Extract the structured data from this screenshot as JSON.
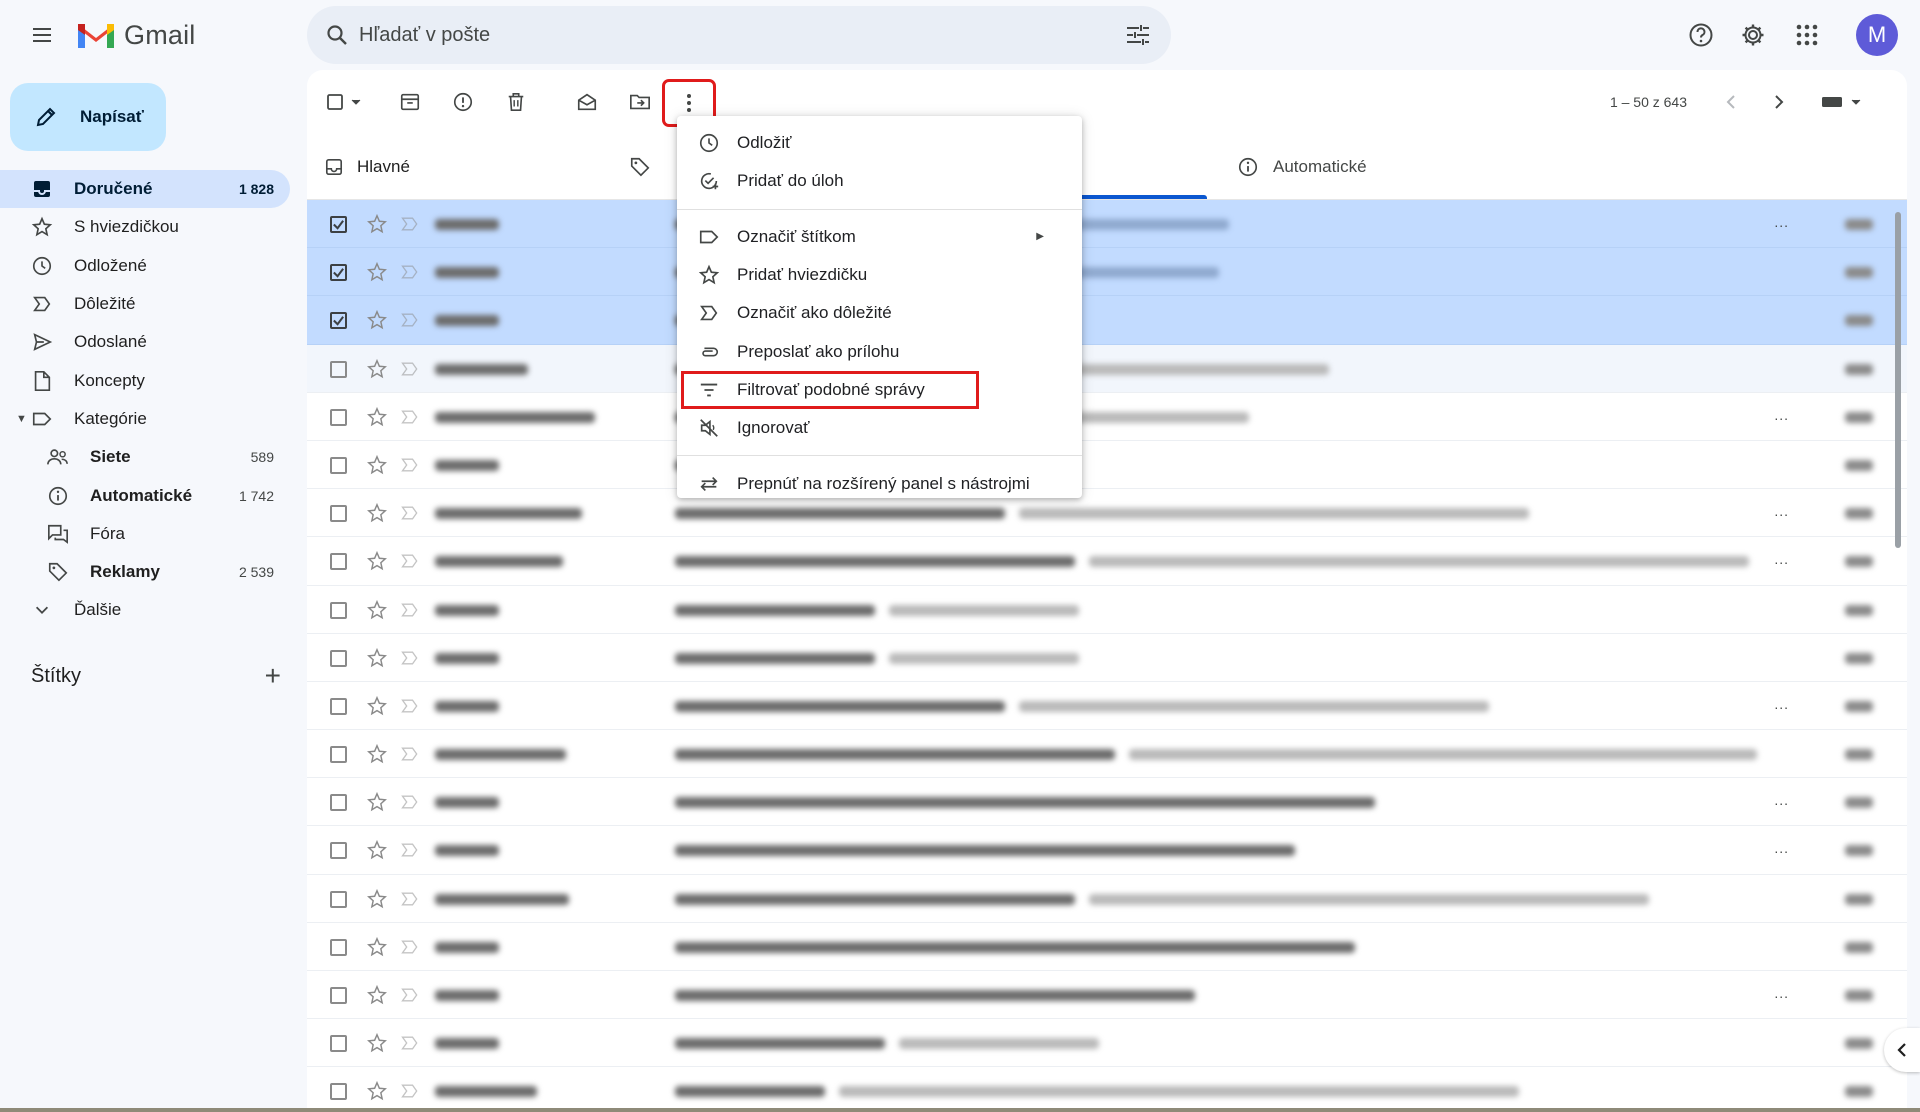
{
  "app": {
    "name": "Gmail",
    "avatar_letter": "M"
  },
  "search": {
    "placeholder": "Hľadať v pošte"
  },
  "compose": {
    "label": "Napísať"
  },
  "sidebar": {
    "items": [
      {
        "label": "Doručené",
        "count": "1 828"
      },
      {
        "label": "S hviezdičkou",
        "count": ""
      },
      {
        "label": "Odložené",
        "count": ""
      },
      {
        "label": "Dôležité",
        "count": ""
      },
      {
        "label": "Odoslané",
        "count": ""
      },
      {
        "label": "Koncepty",
        "count": ""
      },
      {
        "label": "Kategórie",
        "count": ""
      },
      {
        "label": "Siete",
        "count": "589"
      },
      {
        "label": "Automatické",
        "count": "1 742"
      },
      {
        "label": "Fóra",
        "count": ""
      },
      {
        "label": "Reklamy",
        "count": "2 539"
      },
      {
        "label": "Ďalšie",
        "count": ""
      }
    ],
    "labels_title": "Štítky",
    "labels_add": "+"
  },
  "toolbar": {
    "pagination": "1 – 50 z 643"
  },
  "tabs": [
    {
      "label": "Hlavné"
    },
    {
      "label": "Automatické"
    }
  ],
  "tab_partial_letter": "I",
  "menu": {
    "items": [
      {
        "label": "Odložiť"
      },
      {
        "label": "Pridať do úloh"
      },
      {
        "label": "Označiť štítkom"
      },
      {
        "label": "Pridať hviezdičku"
      },
      {
        "label": "Označiť ako dôležité"
      },
      {
        "label": "Preposlať ako prílohu"
      },
      {
        "label": "Filtrovať podobné správy"
      },
      {
        "label": "Ignorovať"
      },
      {
        "label": "Prepnúť na rozšírený panel s nástrojmi"
      }
    ]
  },
  "row_dots": "...",
  "colors": {
    "accent": "#0b57d0",
    "compose_bg": "#c2e7ff",
    "selected_row": "#c2dbff",
    "highlight_outline": "#e01b1b",
    "avatar": "#5e5bd8"
  }
}
